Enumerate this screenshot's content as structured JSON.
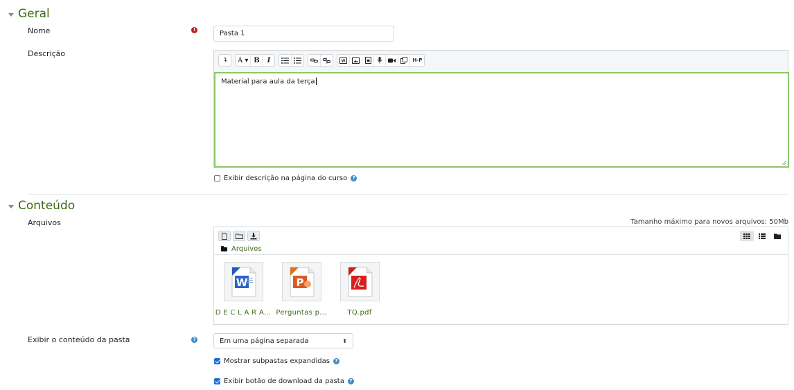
{
  "geral": {
    "title": "Geral",
    "nome_label": "Nome",
    "nome_value": "Pasta 1",
    "descricao_label": "Descrição",
    "descricao_text": "Material para aula da terça",
    "show_desc_label": "Exibir descrição na página do curso"
  },
  "toolbar": {
    "groups": [
      [
        "collapse-icon"
      ],
      [
        "font-style-dropdown",
        "bold",
        "italic"
      ],
      [
        "bullet-list-icon",
        "numbered-list-icon"
      ],
      [
        "link-icon",
        "unlink-icon"
      ],
      [
        "word-paste-icon",
        "image-icon",
        "media-file-icon",
        "microphone-icon",
        "video-camera-icon",
        "copy-icon",
        "h5p-icon"
      ]
    ],
    "font_label": "A",
    "bold_label": "B",
    "italic_label": "I",
    "h5p_label": "H-P"
  },
  "conteudo": {
    "title": "Conteúdo",
    "arquivos_label": "Arquivos",
    "max_size": "Tamanho máximo para novos arquivos: 50Mb",
    "path_label": "Arquivos",
    "files": [
      {
        "name": "D E C L A R A...",
        "type": "word"
      },
      {
        "name": "Perguntas p...",
        "type": "powerpoint"
      },
      {
        "name": "TQ.pdf",
        "type": "pdf"
      }
    ],
    "display_label": "Exibir o conteúdo da pasta",
    "display_value": "Em uma página separada",
    "subfolders_label": "Mostrar subpastas expandidas",
    "download_label": "Exibir botão de download da pasta"
  },
  "colors": {
    "accent_green": "#3f6a14",
    "focus_border": "#8cc56a",
    "checkbox_blue": "#1a6fd6",
    "required_red": "#c41e1e",
    "help_blue": "#3a8dc8"
  }
}
